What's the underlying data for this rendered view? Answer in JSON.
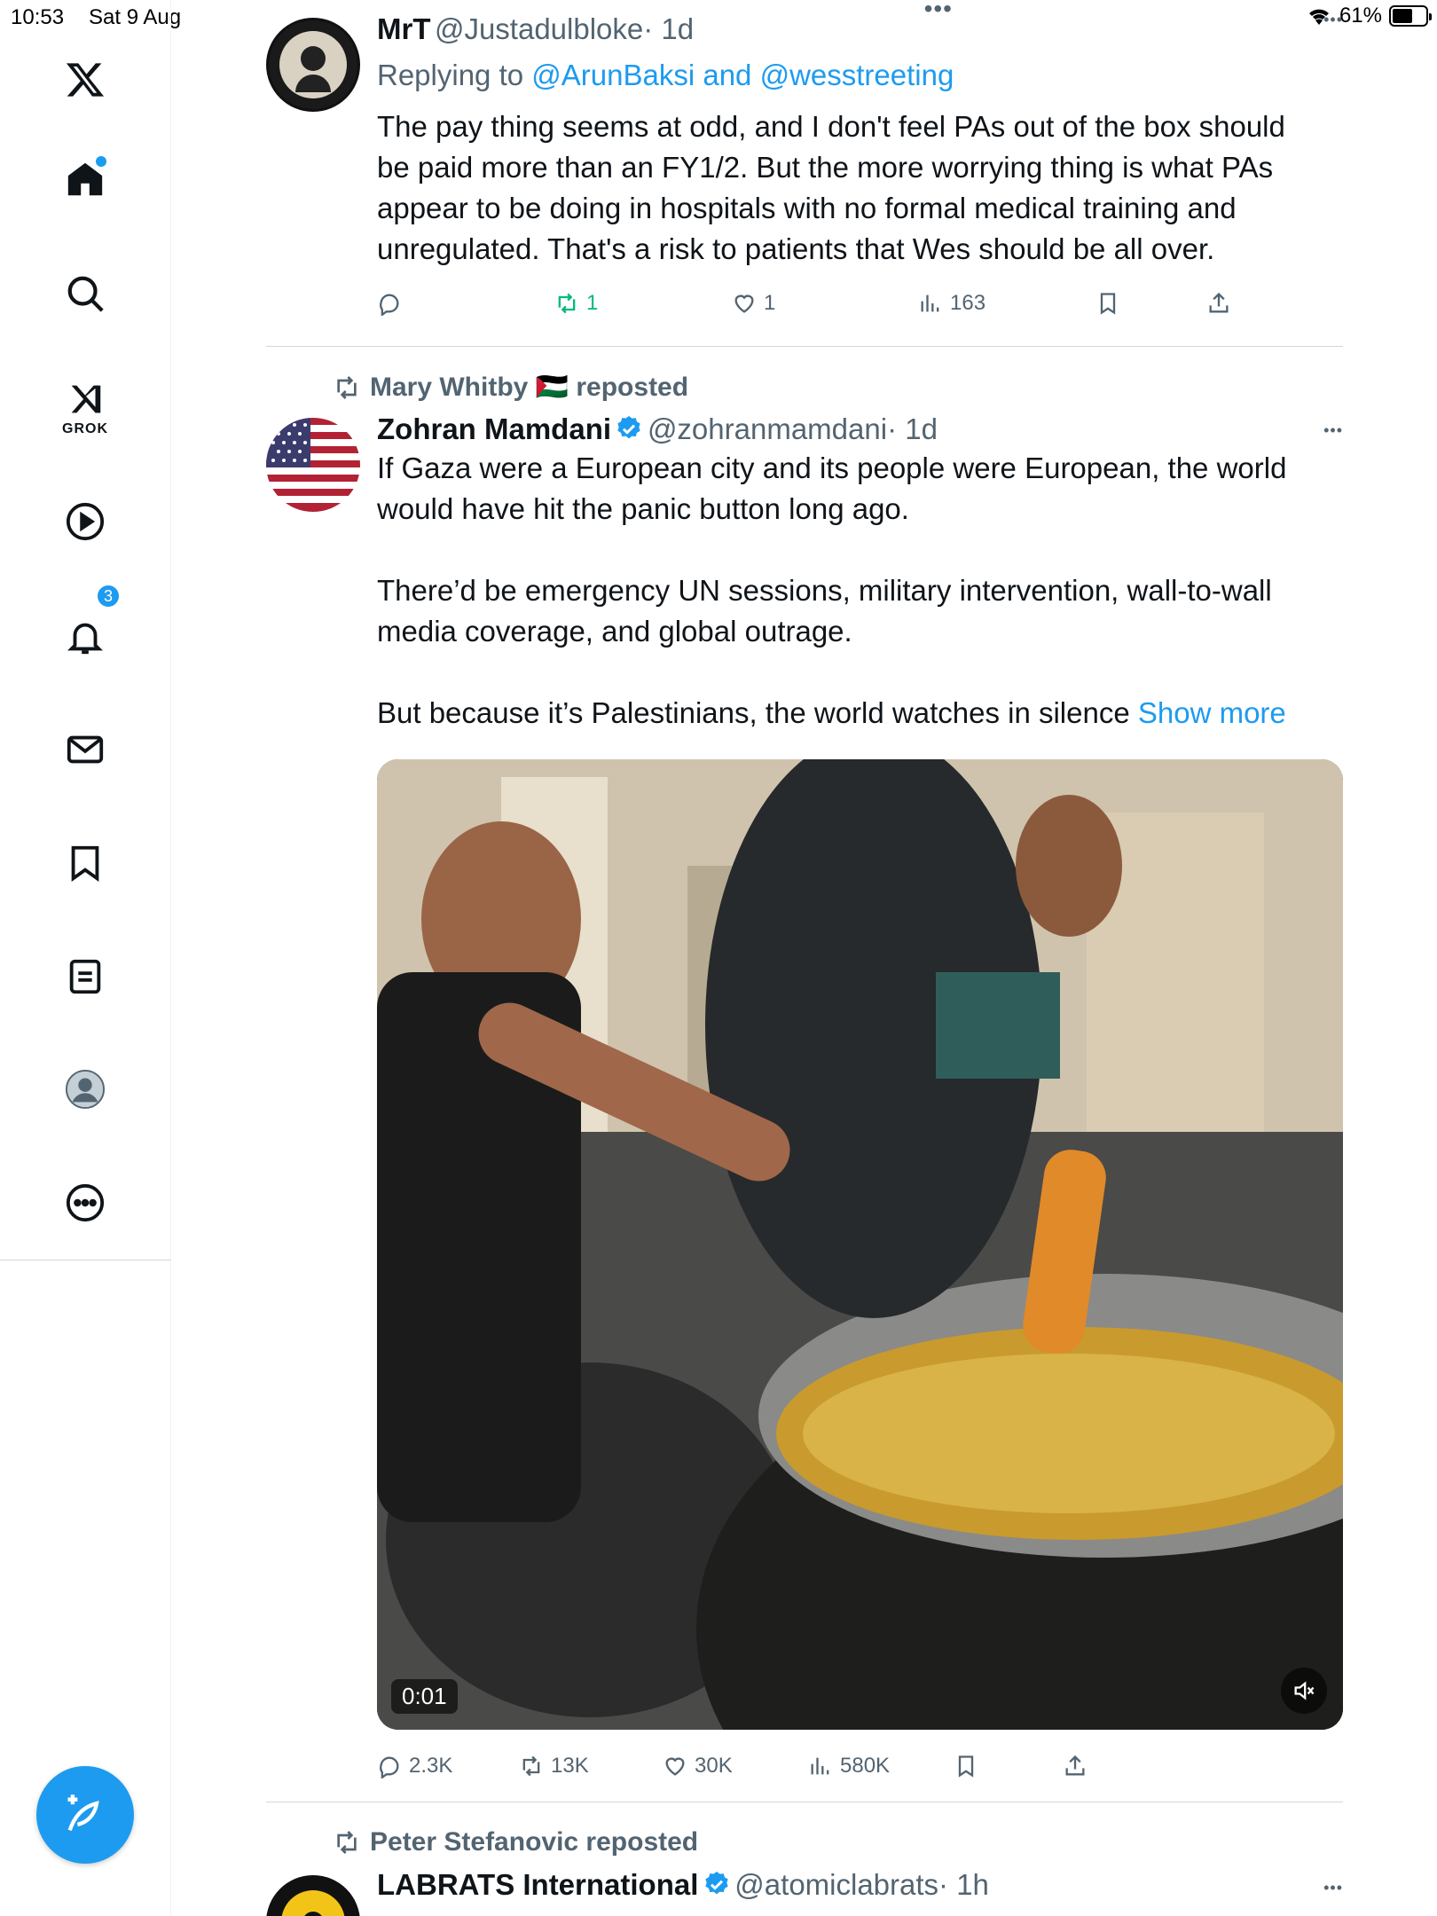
{
  "status_bar": {
    "time": "10:53",
    "date": "Sat 9 Aug",
    "battery": "61%",
    "battery_level": 0.61
  },
  "sidebar": {
    "grok_label": "GROK",
    "notifications_count": "3"
  },
  "tweets": [
    {
      "name": "MrT",
      "handle": "@Justadulbloke",
      "time": "· 1d",
      "reply_prefix": "Replying to",
      "reply_to": "@ArunBaksi and @wesstreeting",
      "lines": [
        "The pay thing seems at odd, and I don't feel PAs out of the box should",
        "be paid more than an FY1/2.  But the more worrying thing is what PAs",
        "appear to be doing in hospitals with no formal medical training and",
        "unregulated. That's a risk to patients that Wes should be all over."
      ],
      "retweets": "1",
      "likes": "1",
      "views": "163"
    },
    {
      "repost_by": "Mary Whitby 🇵🇸 reposted",
      "name": "Zohran Mamdani",
      "handle": "@zohranmamdani",
      "time": "· 1d",
      "para1": [
        "If Gaza were a European city and its people were European, the world",
        "would have hit the panic button long ago."
      ],
      "para2": [
        "There’d be emergency UN sessions, military intervention, wall-to-wall",
        "media coverage, and global outrage."
      ],
      "para3": "But because it’s Palestinians, the world watches in silence",
      "show_more": "Show more",
      "video_time": "0:01",
      "replies": "2.3K",
      "retweets": "13K",
      "likes": "30K",
      "views": "580K"
    },
    {
      "repost_by": "Peter Stefanovic reposted",
      "name": "LABRATS International",
      "handle": "@atomiclabrats",
      "time": "· 1h"
    }
  ]
}
